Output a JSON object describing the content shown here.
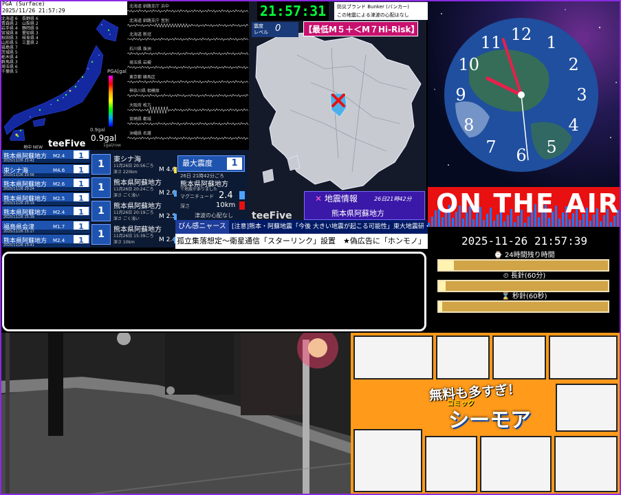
{
  "pga": {
    "header_title": "PGA (Surface)",
    "header_time": "2025/11/26 21:57:29",
    "stations_col1": [
      "北海道 6",
      "青森県 2",
      "岩手県 4",
      "宮城県 8",
      "秋田県 3",
      "山形県 5",
      "福島県 7",
      "茨城県 5",
      "栃木県 4",
      "群馬県 3",
      "埼玉県 6",
      "千葉県 5"
    ],
    "stations_col2": [
      "長野県 6",
      "山梨県 2",
      "静岡県 9",
      "愛知県 3",
      "岐阜県 4",
      "三重県 2"
    ],
    "scale_label": "PGA[gal]",
    "small_value": "0.9gal",
    "big_value": "0.9gal"
  },
  "waveform": {
    "stations": [
      "北海道 釧路支庁 浜中",
      "北海道 釧路支庁 音別",
      "北海道 新冠",
      "石川県 珠洲",
      "埼玉県 岩槻",
      "東京都 練馬区",
      "神奈川県 相模原",
      "大阪府 枚方",
      "宮崎県 都城",
      "沖縄県 名護"
    ],
    "scale": "1gal/row"
  },
  "kmap": {
    "clock": "21:57:31",
    "bunker_line1": "防災ブランド Bunker (バンカー)",
    "bunker_line2": "この地震による津波の心配はなし",
    "shindo_level_label": "震度\nレベル",
    "shindo_level_value": "0",
    "warning_tag": "【最低M５＋＜M７Hi-Risk】",
    "brand": "teeFive",
    "info_title": "地震情報",
    "info_time": "26日21時42分",
    "info_area": "熊本県阿蘇地方"
  },
  "clock_face": {
    "numbers": [
      "12",
      "1",
      "2",
      "3",
      "4",
      "5",
      "6",
      "7",
      "8",
      "9",
      "10",
      "11"
    ],
    "hour_hand_deg": 296,
    "minute_hand_deg": 342,
    "second_hand_deg": 174
  },
  "onair": {
    "text": "ON THE AIR"
  },
  "eew": {
    "new_label": "地中 NEW",
    "brand": "teeFive",
    "rows": [
      {
        "name": "熊本県阿蘇地方",
        "date": "2025/11/26 21:42",
        "mag": "M2.4",
        "int": "1"
      },
      {
        "name": "東シナ海",
        "date": "2025/11/26 20:56",
        "mag": "M4.6",
        "int": "1"
      },
      {
        "name": "熊本県阿蘇地方",
        "date": "2025/11/26 20:24",
        "mag": "M2.6",
        "int": "1"
      },
      {
        "name": "熊本県阿蘇地方",
        "date": "2025/11/26 20:19",
        "mag": "M2.5",
        "int": "1"
      },
      {
        "name": "熊本県阿蘇地方",
        "date": "2025/11/26 15:39",
        "mag": "M2.4",
        "int": "1"
      },
      {
        "name": "福島県会津",
        "date": "2025/11/26 15:17",
        "mag": "M1.7",
        "int": "1"
      },
      {
        "name": "熊本県阿蘇地方",
        "date": "2025/11/26 13:41",
        "mag": "M2.4",
        "int": "1"
      }
    ]
  },
  "cards": [
    {
      "int": "1",
      "name": "東シナ海",
      "time": "11月26日 20:56ごろ",
      "depth": "深さ 220km",
      "mag": "M 4.6",
      "bar": "#f4e04d"
    },
    {
      "int": "1",
      "name": "熊本県阿蘇地方",
      "time": "11月26日 20:24ごろ",
      "depth": "深さ ごく浅い",
      "mag": "M 2.6",
      "bar": "#4da3ff"
    },
    {
      "int": "1",
      "name": "熊本県阿蘇地方",
      "time": "11月26日 20:19ごろ",
      "depth": "深さ ごく浅い",
      "mag": "M 2.5",
      "bar": "#4da3ff"
    },
    {
      "int": "1",
      "name": "熊本県阿蘇地方",
      "time": "11月26日 15:39ごろ",
      "depth": "深さ 10km",
      "mag": "M 2.4",
      "bar": "#4da3ff"
    }
  ],
  "maxbox": {
    "title": "最大震度",
    "int": "1",
    "time": "26日 21時42分ごろ",
    "area": "熊本県阿蘇地方",
    "sub": "で地震がありました",
    "mag_label": "マグニチュード",
    "mag": "2.4",
    "depth_label": "深さ",
    "depth": "10km",
    "tsunami": "津波の心配なし"
  },
  "ticker": {
    "pinkan": "びん感ニャース",
    "line1": "[注意]熊本・阿蘇地震「今後 大きい地震が起こる可能性」東大地震研・笠原教授",
    "line2": "孤立集落想定〜衛星通信「スターリンク」設置　★偽広告に「ホンモノ」"
  },
  "timers": {
    "datetime": "2025-11-26 21:57:39",
    "items": [
      {
        "label": "⌚ 24時間残り時間",
        "fill": 0.09
      },
      {
        "label": "⏲ 長針(60分)",
        "fill": 0.04
      },
      {
        "label": "⌛ 秒針(60秒)",
        "fill": 0.02
      }
    ]
  },
  "ad": {
    "title1": "無料も多すぎ！",
    "title2": "コミック",
    "title3": "シーモア"
  },
  "colors": {
    "accent_blue": "#1e54b0",
    "onair_red": "#e81010",
    "clock_green": "#00ff3a",
    "warning_pink": "#c8106e",
    "timer_gold": "#d1a447",
    "frame_purple": "#8a2be2"
  }
}
